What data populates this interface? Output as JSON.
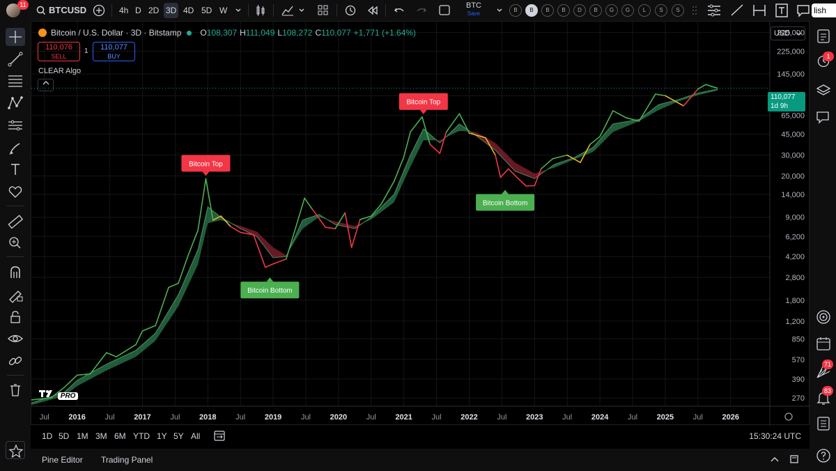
{
  "topbar": {
    "avatar_badge": "11",
    "symbol": "BTCUSD",
    "intervals": [
      "4h",
      "D",
      "2D",
      "3D",
      "4D",
      "5D",
      "W"
    ],
    "active_interval": "3D",
    "layout_name": "BTC",
    "save_label": "Save",
    "publish_label": "lish",
    "quick_badges": [
      "B",
      "B",
      "B",
      "B",
      "D",
      "B",
      "G",
      "G",
      "L",
      "S",
      "S"
    ]
  },
  "legend": {
    "title": "Bitcoin / U.S. Dollar · 3D · Bitstamp",
    "open_label": "O",
    "open": "108,307",
    "high_label": "H",
    "high": "111,049",
    "low_label": "L",
    "low": "108,272",
    "close_label": "C",
    "close": "110,077",
    "change": "+1,771 (+1.64%)"
  },
  "trade": {
    "sell_price": "110,076",
    "sell_label": "SELL",
    "spread": "1",
    "buy_price": "110,077",
    "buy_label": "BUY"
  },
  "indicator": {
    "name": "CLEAR Algo"
  },
  "currency": "USD",
  "price_tag": {
    "price": "110,077",
    "countdown": "1d 9h"
  },
  "logo": {
    "pro": "PRO"
  },
  "right_badges": {
    "alerts": "1",
    "ideas": "71",
    "notifications": "83"
  },
  "timeframes": [
    "1D",
    "5D",
    "1M",
    "3M",
    "6M",
    "YTD",
    "1Y",
    "5Y",
    "All"
  ],
  "clock": "15:30:24 UTC",
  "bottom_tabs": [
    "Pine Editor",
    "Trading Panel"
  ],
  "chart_data": {
    "type": "line",
    "log_scale": true,
    "ylim": [
      230,
      400000
    ],
    "xlim": [
      2015.3,
      2026.6
    ],
    "y_ticks": [
      270,
      390,
      570,
      850,
      1200,
      1800,
      2800,
      4200,
      6200,
      9000,
      14000,
      20000,
      30000,
      45000,
      65000,
      95000,
      145000,
      225000,
      325000
    ],
    "x_ticks": [
      {
        "x": 2015.5,
        "label": "Jul"
      },
      {
        "x": 2016.0,
        "label": "2016"
      },
      {
        "x": 2016.5,
        "label": "Jul"
      },
      {
        "x": 2017.0,
        "label": "2017"
      },
      {
        "x": 2017.5,
        "label": "Jul"
      },
      {
        "x": 2018.0,
        "label": "2018"
      },
      {
        "x": 2018.5,
        "label": "Jul"
      },
      {
        "x": 2019.0,
        "label": "2019"
      },
      {
        "x": 2019.5,
        "label": "Jul"
      },
      {
        "x": 2020.0,
        "label": "2020"
      },
      {
        "x": 2020.5,
        "label": "Jul"
      },
      {
        "x": 2021.0,
        "label": "2021"
      },
      {
        "x": 2021.5,
        "label": "Jul"
      },
      {
        "x": 2022.0,
        "label": "2022"
      },
      {
        "x": 2022.5,
        "label": "Jul"
      },
      {
        "x": 2023.0,
        "label": "2023"
      },
      {
        "x": 2023.5,
        "label": "Jul"
      },
      {
        "x": 2024.0,
        "label": "2024"
      },
      {
        "x": 2024.5,
        "label": "Jul"
      },
      {
        "x": 2025.0,
        "label": "2025"
      },
      {
        "x": 2025.5,
        "label": "Jul"
      },
      {
        "x": 2026.0,
        "label": "2026"
      }
    ],
    "last_price": 110077,
    "series": [
      {
        "values": [
          [
            2015.3,
            260
          ],
          [
            2015.6,
            270
          ],
          [
            2015.8,
            330
          ],
          [
            2016.0,
            420
          ],
          [
            2016.2,
            430
          ],
          [
            2016.45,
            650
          ],
          [
            2016.6,
            600
          ],
          [
            2016.9,
            760
          ],
          [
            2017.0,
            990
          ],
          [
            2017.2,
            1100
          ],
          [
            2017.4,
            2300
          ],
          [
            2017.55,
            2500
          ],
          [
            2017.7,
            4300
          ],
          [
            2017.85,
            7000
          ],
          [
            2017.97,
            19000
          ],
          [
            2018.08,
            8500
          ],
          [
            2018.2,
            9200
          ],
          [
            2018.35,
            7500
          ],
          [
            2018.5,
            6700
          ],
          [
            2018.7,
            6400
          ],
          [
            2018.88,
            3400
          ],
          [
            2018.98,
            3600
          ],
          [
            2019.2,
            4000
          ],
          [
            2019.35,
            7500
          ],
          [
            2019.48,
            13000
          ],
          [
            2019.6,
            10500
          ],
          [
            2019.8,
            7400
          ],
          [
            2019.95,
            7200
          ],
          [
            2020.1,
            9800
          ],
          [
            2020.2,
            5000
          ],
          [
            2020.33,
            8600
          ],
          [
            2020.5,
            9200
          ],
          [
            2020.65,
            11500
          ],
          [
            2020.85,
            18000
          ],
          [
            2021.0,
            29000
          ],
          [
            2021.1,
            47000
          ],
          [
            2021.28,
            63000
          ],
          [
            2021.4,
            37000
          ],
          [
            2021.55,
            31000
          ],
          [
            2021.65,
            47000
          ],
          [
            2021.85,
            67000
          ],
          [
            2022.0,
            46000
          ],
          [
            2022.25,
            42000
          ],
          [
            2022.4,
            30000
          ],
          [
            2022.48,
            19500
          ],
          [
            2022.6,
            23000
          ],
          [
            2022.75,
            19000
          ],
          [
            2022.87,
            16500
          ],
          [
            2023.0,
            16600
          ],
          [
            2023.1,
            23000
          ],
          [
            2023.28,
            28000
          ],
          [
            2023.5,
            30000
          ],
          [
            2023.7,
            26000
          ],
          [
            2023.85,
            37000
          ],
          [
            2024.0,
            43000
          ],
          [
            2024.2,
            71000
          ],
          [
            2024.4,
            62000
          ],
          [
            2024.6,
            58000
          ],
          [
            2024.85,
            98000
          ],
          [
            2025.0,
            95000
          ],
          [
            2025.28,
            78000
          ],
          [
            2025.5,
            108000
          ],
          [
            2025.62,
            118000
          ],
          [
            2025.75,
            112000
          ],
          [
            2025.8,
            110077
          ]
        ]
      },
      {
        "values": [
          [
            2015.3,
            245
          ],
          [
            2015.8,
            300
          ],
          [
            2016.0,
            380
          ],
          [
            2016.45,
            520
          ],
          [
            2016.9,
            680
          ],
          [
            2017.2,
            950
          ],
          [
            2017.55,
            2000
          ],
          [
            2017.85,
            4800
          ],
          [
            2018.0,
            11000
          ],
          [
            2018.2,
            9000
          ],
          [
            2018.5,
            7200
          ],
          [
            2018.75,
            6200
          ],
          [
            2019.0,
            4100
          ],
          [
            2019.2,
            4200
          ],
          [
            2019.45,
            8500
          ],
          [
            2019.7,
            9500
          ],
          [
            2019.95,
            7800
          ],
          [
            2020.25,
            7200
          ],
          [
            2020.5,
            9000
          ],
          [
            2020.85,
            14000
          ],
          [
            2021.1,
            30000
          ],
          [
            2021.3,
            50000
          ],
          [
            2021.55,
            38000
          ],
          [
            2021.85,
            55000
          ],
          [
            2022.1,
            44000
          ],
          [
            2022.4,
            33000
          ],
          [
            2022.7,
            22000
          ],
          [
            2023.0,
            19000
          ],
          [
            2023.3,
            25000
          ],
          [
            2023.6,
            28500
          ],
          [
            2023.9,
            35000
          ],
          [
            2024.2,
            55000
          ],
          [
            2024.6,
            60000
          ],
          [
            2024.9,
            80000
          ],
          [
            2025.2,
            88000
          ],
          [
            2025.5,
            100000
          ],
          [
            2025.8,
            108000
          ]
        ]
      },
      {
        "values": [
          [
            2015.3,
            235
          ],
          [
            2015.8,
            280
          ],
          [
            2016.0,
            340
          ],
          [
            2016.45,
            460
          ],
          [
            2016.9,
            600
          ],
          [
            2017.2,
            820
          ],
          [
            2017.55,
            1600
          ],
          [
            2017.85,
            3600
          ],
          [
            2018.0,
            8000
          ],
          [
            2018.2,
            8500
          ],
          [
            2018.5,
            7600
          ],
          [
            2018.75,
            6800
          ],
          [
            2019.0,
            5000
          ],
          [
            2019.2,
            4300
          ],
          [
            2019.45,
            7200
          ],
          [
            2019.7,
            9000
          ],
          [
            2019.95,
            8300
          ],
          [
            2020.25,
            7600
          ],
          [
            2020.5,
            8600
          ],
          [
            2020.85,
            12000
          ],
          [
            2021.1,
            24000
          ],
          [
            2021.3,
            40000
          ],
          [
            2021.55,
            40000
          ],
          [
            2021.85,
            48000
          ],
          [
            2022.1,
            47000
          ],
          [
            2022.4,
            38000
          ],
          [
            2022.7,
            26000
          ],
          [
            2023.0,
            21000
          ],
          [
            2023.3,
            23500
          ],
          [
            2023.6,
            27500
          ],
          [
            2023.9,
            32000
          ],
          [
            2024.2,
            47000
          ],
          [
            2024.6,
            58000
          ],
          [
            2024.9,
            72000
          ],
          [
            2025.2,
            85000
          ],
          [
            2025.5,
            96000
          ],
          [
            2025.8,
            105000
          ]
        ]
      }
    ],
    "annotations": [
      {
        "label": "Bitcoin Top",
        "x": 2017.97,
        "y": 19000,
        "type": "top"
      },
      {
        "label": "Bitcoin Bottom",
        "x": 2018.95,
        "y": 3200,
        "type": "bottom"
      },
      {
        "label": "Bitcoin Top",
        "x": 2021.3,
        "y": 63000,
        "type": "top"
      },
      {
        "label": "Bitcoin Bottom",
        "x": 2022.55,
        "y": 17500,
        "type": "bottom"
      }
    ],
    "colors": {
      "bull": "#4caf50",
      "bear": "#f23645",
      "neutral": "#e9b826",
      "band_bull": "#2e7d4f",
      "band_bear": "#8c2331",
      "top_label": "#f23645",
      "bottom_label": "#4caf50"
    }
  }
}
